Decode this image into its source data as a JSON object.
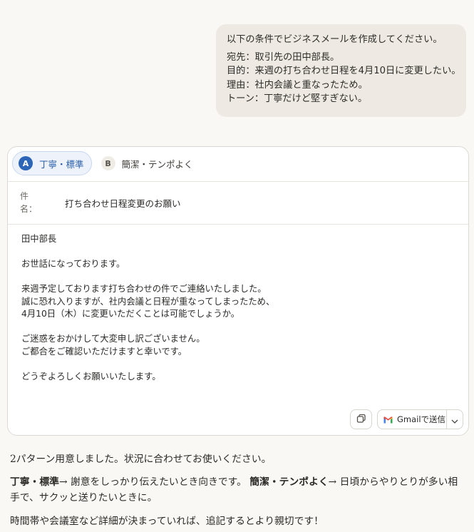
{
  "user_message": {
    "intro": "以下の条件でビジネスメールを作成してください。",
    "lines": [
      "宛先：取引先の田中部長。",
      "目的：来週の打ち合わせ日程を4月10日に変更したい。",
      "理由：社内会議と重なったため。",
      "トーン：丁寧だけど堅すぎない。"
    ]
  },
  "email_card": {
    "tabs": [
      {
        "badge": "A",
        "label": "丁寧・標準",
        "active": true
      },
      {
        "badge": "B",
        "label": "簡潔・テンポよく",
        "active": false
      }
    ],
    "subject_label": "件名：",
    "subject": "打ち合わせ日程変更のお願い",
    "body": "田中部長\n\nお世話になっております。\n\n来週予定しております打ち合わせの件でご連絡いたしました。\n誠に恐れ入りますが、社内会議と日程が重なってしまったため、\n4月10日（木）に変更いただくことは可能でしょうか。\n\nご迷惑をおかけして大変申し訳ございません。\nご都合をご確認いただけますと幸いです。\n\nどうぞよろしくお願いいたします。",
    "copy_icon": "copy-icon",
    "send_label": "Gmailで送信",
    "gmail_icon": "gmail-icon",
    "dropdown_icon": "chevron-down-icon"
  },
  "assistant": {
    "line1": "2パターン用意しました。状況に合わせてお使いください。",
    "para2": {
      "a_label": "丁寧・標準",
      "a_text": "→ 謝意をしっかり伝えたいとき向きです。",
      "b_label": "簡潔・テンポよく",
      "b_text": "→ 日頃からやりとりが多い相手で、サクッと送りたいときに。"
    },
    "line3": "時間帯や会議室など詳細が決まっていれば、追記するとより親切です！"
  },
  "colors": {
    "accent": "#2d66b6",
    "bubble": "#eeeae3",
    "background": "#f9f8f5"
  }
}
